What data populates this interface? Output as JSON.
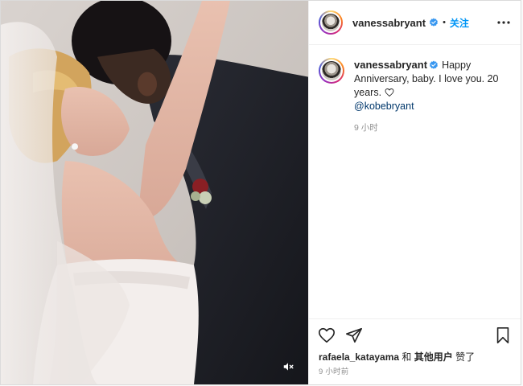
{
  "post": {
    "author": "vanessabryant",
    "follow_label": "关注",
    "header_dot": "•",
    "caption_text": "Happy Anniversary, baby. I love you. 20 years.",
    "caption_mention": "@kobebryant",
    "caption_time": "9 小时",
    "likes_user": "rafaela_katayama",
    "likes_and": "和",
    "likes_others": "其他用户",
    "likes_suffix": "赞了",
    "posted_time": "9 小时前"
  },
  "icons": {
    "header_more": "more-icon",
    "verified": "verified-badge-icon",
    "mute": "volume-muted-icon",
    "like": "heart-icon",
    "share": "paper-plane-icon",
    "save": "bookmark-icon"
  },
  "colors": {
    "link_blue": "#0095f6",
    "mention": "#00376b",
    "muted_text": "#8e8e8e",
    "border": "#dbdbdb"
  }
}
